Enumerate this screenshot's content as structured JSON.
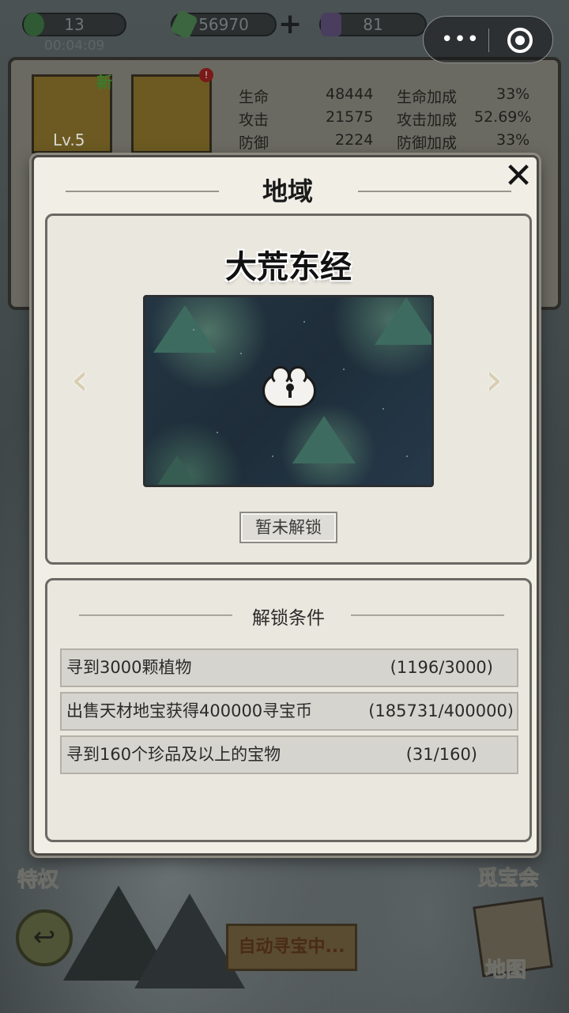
{
  "hud": {
    "energy": "13",
    "timer": "00:04:09",
    "gold": "56970",
    "gems": "81",
    "plus": "+"
  },
  "miniprogram": {
    "menu_icon": "•••"
  },
  "info": {
    "level": "Lv.5",
    "new_tag": "新",
    "alert": "!",
    "stats": [
      {
        "label": "生命",
        "value": "48444",
        "bonus_label": "生命加成",
        "bonus": "33%"
      },
      {
        "label": "攻击",
        "value": "21575",
        "bonus_label": "攻击加成",
        "bonus": "52.69%"
      },
      {
        "label": "防御",
        "value": "2224",
        "bonus_label": "防御加成",
        "bonus": "33%"
      }
    ]
  },
  "bottom": {
    "privilege": "特权",
    "treasure_meet": "觅宝会",
    "auto_search": "自动寻宝中...",
    "map": "地图",
    "back_icon": "↩"
  },
  "dialog": {
    "title": "地域",
    "close": "✕",
    "region_name": "大荒东经",
    "prev": "‹",
    "next": "›",
    "locked_label": "暂未解锁",
    "conditions_title": "解锁条件",
    "conditions": [
      {
        "text": "寻到3000颗植物",
        "progress": "(1196/3000)"
      },
      {
        "text": "出售天材地宝获得400000寻宝币",
        "progress": "(185731/400000)"
      },
      {
        "text": "寻到160个珍品及以上的宝物",
        "progress": "(31/160)"
      }
    ]
  }
}
